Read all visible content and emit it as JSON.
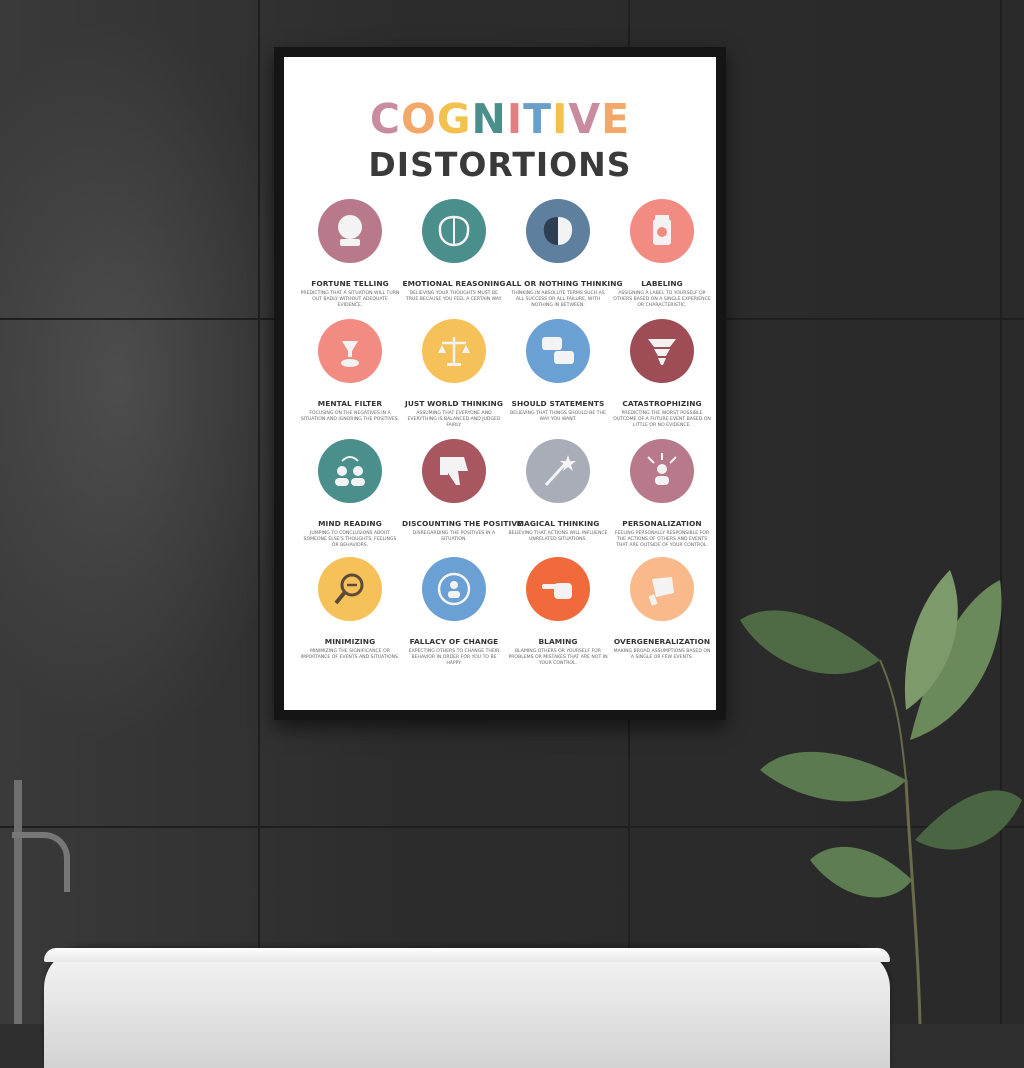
{
  "poster": {
    "title_line1_letters": [
      {
        "ch": "C",
        "color": "#c98ba0"
      },
      {
        "ch": "O",
        "color": "#f3a86a"
      },
      {
        "ch": "G",
        "color": "#f2c14e"
      },
      {
        "ch": "N",
        "color": "#4a8f8c"
      },
      {
        "ch": "I",
        "color": "#e47f7f"
      },
      {
        "ch": "T",
        "color": "#6aa0c8"
      },
      {
        "ch": "I",
        "color": "#f2c14e"
      },
      {
        "ch": "V",
        "color": "#c98ba0"
      },
      {
        "ch": "E",
        "color": "#f3a86a"
      }
    ],
    "title_line2": "DISTORTIONS",
    "items": [
      {
        "name": "FORTUNE TELLING",
        "desc": "PREDICTING THAT A SITUATION WILL TURN OUT BADLY WITHOUT ADEQUATE EVIDENCE.",
        "color": "#b87a8a",
        "icon": "crystal-ball-icon"
      },
      {
        "name": "EMOTIONAL REASONING",
        "desc": "BELIEVING YOUR THOUGHTS MUST BE TRUE BECAUSE YOU FEEL A CERTAIN WAY.",
        "color": "#4a8f8c",
        "icon": "brain-icon"
      },
      {
        "name": "ALL OR NOTHING THINKING",
        "desc": "THINKING IN ABSOLUTE TERMS SUCH AS ALL SUCCESS OR ALL FAILURE, WITH NOTHING IN BETWEEN.",
        "color": "#5e7f9e",
        "icon": "half-brain-icon"
      },
      {
        "name": "LABELING",
        "desc": "ASSIGNING A LABEL TO YOURSELF OR OTHERS BASED ON A SINGLE EXPERIENCE OR CHARACTERISTIC.",
        "color": "#f28b82",
        "icon": "jar-label-icon"
      },
      {
        "name": "MENTAL FILTER",
        "desc": "FOCUSING ON THE NEGATIVES IN A SITUATION AND IGNORING THE POSITIVES.",
        "color": "#f28b82",
        "icon": "filter-icon"
      },
      {
        "name": "JUST WORLD THINKING",
        "desc": "ASSUMING THAT EVERYONE AND EVERYTHING IS BALANCED AND JUDGED FAIRLY.",
        "color": "#f7c159",
        "icon": "scales-icon"
      },
      {
        "name": "SHOULD STATEMENTS",
        "desc": "BELIEVING THAT THINGS SHOULD BE THE WAY YOU WANT.",
        "color": "#6aa0d4",
        "icon": "speech-bubbles-icon"
      },
      {
        "name": "CATASTROPHIZING",
        "desc": "PREDICTING THE WORST POSSIBLE OUTCOME OF A FUTURE EVENT BASED ON LITTLE OR NO EVIDENCE.",
        "color": "#9e4d56",
        "icon": "tornado-icon"
      },
      {
        "name": "MIND READING",
        "desc": "JUMPING TO CONCLUSIONS ABOUT SOMEONE ELSE'S THOUGHTS, FEELINGS OR BEHAVIORS.",
        "color": "#4a8f8c",
        "icon": "two-people-icon"
      },
      {
        "name": "DISCOUNTING THE POSITIVE",
        "desc": "DISREGARDING THE POSITIVES IN A SITUATION.",
        "color": "#a85660",
        "icon": "thumbs-down-icon"
      },
      {
        "name": "MAGICAL THINKING",
        "desc": "BELIEVING THAT ACTIONS WILL INFLUENCE UNRELATED SITUATIONS.",
        "color": "#a9adb8",
        "icon": "magic-wand-icon"
      },
      {
        "name": "PERSONALIZATION",
        "desc": "FEELING PERSONALLY RESPONSIBLE FOR THE ACTIONS OF OTHERS AND EVENTS THAT ARE OUTSIDE OF YOUR CONTROL.",
        "color": "#b87a8a",
        "icon": "person-arrows-icon"
      },
      {
        "name": "MINIMIZING",
        "desc": "MINIMIZING THE SIGNIFICANCE OR IMPORTANCE OF EVENTS AND SITUATIONS.",
        "color": "#f7c159",
        "icon": "magnifier-minus-icon"
      },
      {
        "name": "FALLACY OF CHANGE",
        "desc": "EXPECTING OTHERS TO CHANGE THEIR BEHAVIOR IN ORDER FOR YOU TO BE HAPPY.",
        "color": "#6aa0d4",
        "icon": "person-cycle-icon"
      },
      {
        "name": "BLAMING",
        "desc": "BLAMING OTHERS OR YOURSELF FOR PROBLEMS OR MISTAKES THAT ARE NOT IN YOUR CONTROL.",
        "color": "#f06a3c",
        "icon": "pointing-hand-icon"
      },
      {
        "name": "OVERGENERALIZATION",
        "desc": "MAKING BROAD ASSUMPTIONS BASED ON A SINGLE OR FEW EVENTS.",
        "color": "#f9b98a",
        "icon": "paintbrush-icon"
      }
    ]
  }
}
